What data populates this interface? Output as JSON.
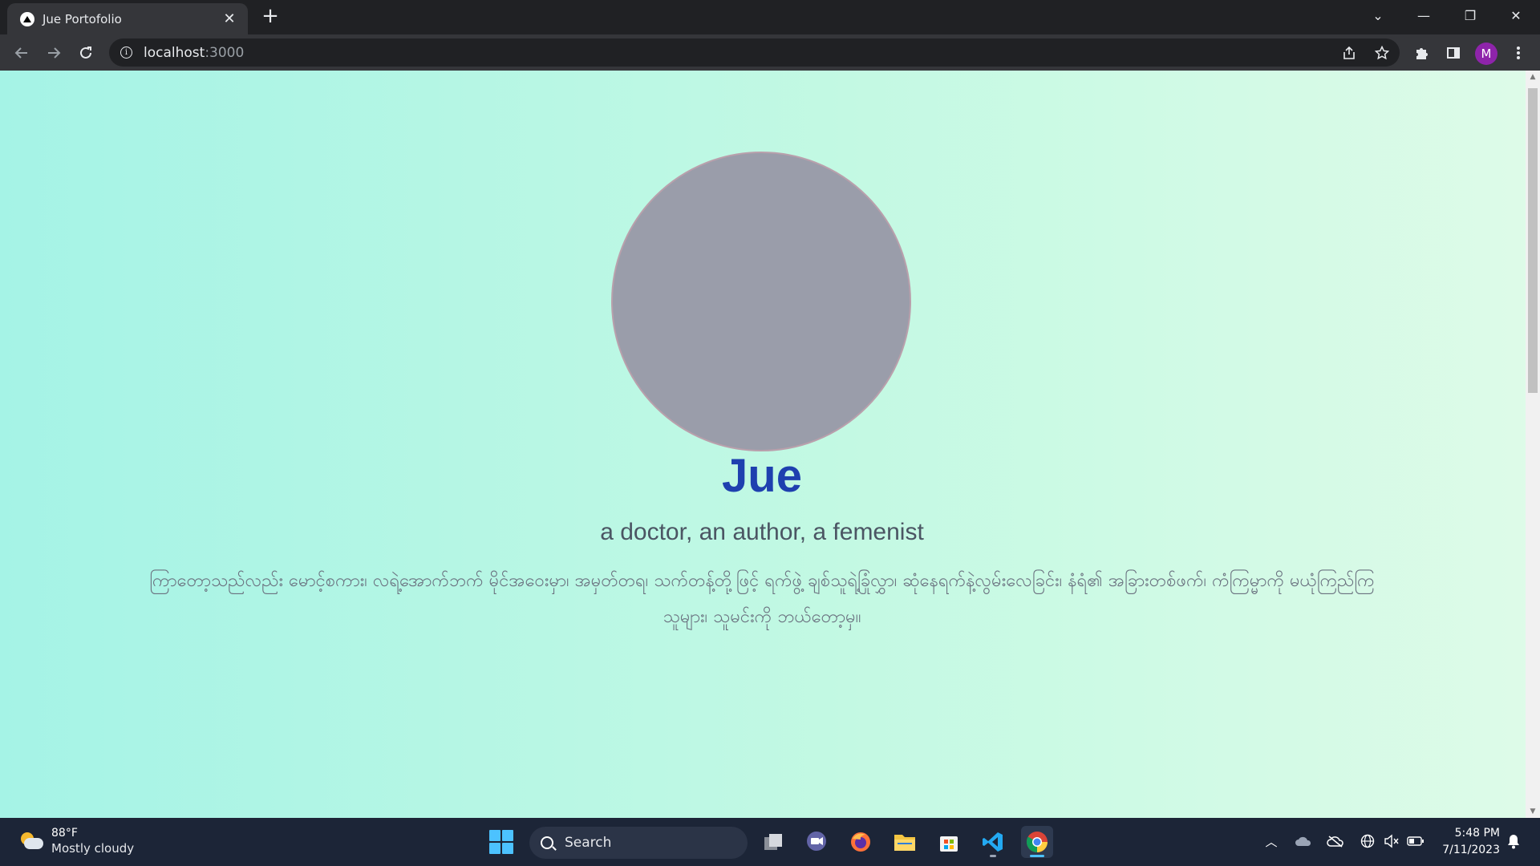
{
  "browser": {
    "tab_title": "Jue Portofolio",
    "tab_close": "✕",
    "new_tab": "+",
    "url_host": "localhost",
    "url_port": ":3000",
    "profile_initial": "M",
    "window_controls": {
      "minimize": "—",
      "maximize": "❐",
      "close": "✕",
      "tab_search": "⌄"
    }
  },
  "page": {
    "name": "Jue",
    "tagline": "a doctor, an author, a femenist",
    "bio": "ကြာတော့သည်လည်း မောင့်စကား၊ လရဲ့အောက်ဘက် မိုင်အဝေးမှာ၊ အမှတ်တရ၊ သက်တန့်တို့ဖြင့် ရက်ဖွဲ့ ချစ်သူရဲ့ခြုံလွှာ၊ ဆုံနေရက်နဲ့လွမ်းလေခြင်း၊ နံရံ၏ အခြားတစ်ဖက်၊ ကံကြမ္မာကို မယုံကြည်ကြသူများ၊ သူမင်းကို ဘယ်တော့မှ။",
    "colors": {
      "bg_left": "#a5f3e6",
      "bg_right": "#defbe8",
      "name": "#1e40af",
      "avatar": "#9a9daa"
    }
  },
  "taskbar": {
    "weather_temp": "88°F",
    "weather_desc": "Mostly cloudy",
    "search_label": "Search",
    "time": "5:48 PM",
    "date": "7/11/2023",
    "apps": [
      "task-view",
      "teams-chat",
      "firefox",
      "file-explorer",
      "microsoft-store",
      "vs-code",
      "chrome"
    ]
  }
}
